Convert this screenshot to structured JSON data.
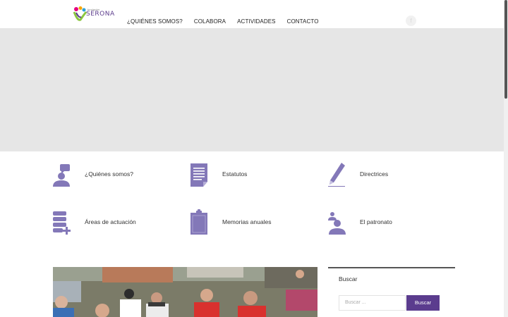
{
  "header": {
    "logo_text": "SERONA",
    "logo_small": "fundación",
    "nav": [
      "¿QUIÉNES SOMOS?",
      "COLABORA",
      "ACTIVIDADES",
      "CONTACTO"
    ],
    "social_icon": "facebook-icon"
  },
  "features": [
    {
      "label": "¿Quiénes somos?",
      "icon": "person-chat-icon"
    },
    {
      "label": "Estatutos",
      "icon": "document-icon"
    },
    {
      "label": "Directrices",
      "icon": "pencil-icon"
    },
    {
      "label": "Áreas de actuación",
      "icon": "list-add-icon"
    },
    {
      "label": "Memorias anuales",
      "icon": "clipboard-icon"
    },
    {
      "label": "El patronato",
      "icon": "people-icon"
    }
  ],
  "sidebar": {
    "title": "Buscar",
    "search_placeholder": "Buscar ...",
    "search_button": "Buscar"
  },
  "colors": {
    "accent": "#5b3c8e",
    "icon": "#8378b8",
    "banner": "#e6e6e6"
  }
}
